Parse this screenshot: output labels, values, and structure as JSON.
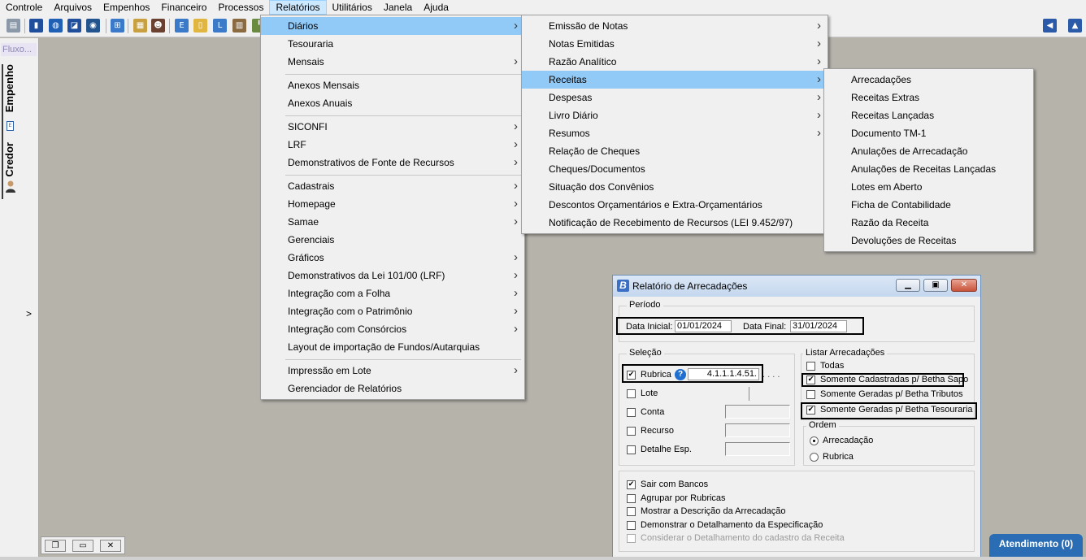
{
  "menubar": [
    "Controle",
    "Arquivos",
    "Empenhos",
    "Financeiro",
    "Processos",
    "Relatórios",
    "Utilitários",
    "Janela",
    "Ajuda"
  ],
  "active_menu": "Relatórios",
  "left_panel": {
    "fluxo_tab": "Fluxo...",
    "vertical_tabs": [
      "Empenho",
      "Credor"
    ],
    "expand_glyph": ">"
  },
  "relatorios_menu": [
    {
      "label": "Diários",
      "submenu": true,
      "highlighted": true
    },
    {
      "label": "Tesouraria",
      "submenu": false
    },
    {
      "label": "Mensais",
      "submenu": true
    },
    {
      "label": "Anexos Mensais",
      "submenu": false
    },
    {
      "label": "Anexos Anuais",
      "submenu": false
    },
    {
      "label": "SICONFI",
      "submenu": true
    },
    {
      "label": "LRF",
      "submenu": true
    },
    {
      "label": "Demonstrativos de Fonte de Recursos",
      "submenu": true
    },
    {
      "label": "Cadastrais",
      "submenu": true
    },
    {
      "label": "Homepage",
      "submenu": true
    },
    {
      "label": "Samae",
      "submenu": true
    },
    {
      "label": "Gerenciais",
      "submenu": false
    },
    {
      "label": "Gráficos",
      "submenu": true
    },
    {
      "label": "Demonstrativos da Lei 101/00 (LRF)",
      "submenu": true
    },
    {
      "label": "Integração com a Folha",
      "submenu": true
    },
    {
      "label": "Integração com o Patrimônio",
      "submenu": true
    },
    {
      "label": "Integração com Consórcios",
      "submenu": true
    },
    {
      "label": "Layout de importação de Fundos/Autarquias",
      "submenu": false
    },
    {
      "label": "Impressão em Lote",
      "submenu": true
    },
    {
      "label": "Gerenciador de Relatórios",
      "submenu": false
    }
  ],
  "diarios_menu": [
    {
      "label": "Emissão de Notas",
      "submenu": true
    },
    {
      "label": "Notas Emitidas",
      "submenu": true
    },
    {
      "label": "Razão Analítico",
      "submenu": true
    },
    {
      "label": "Receitas",
      "submenu": true,
      "highlighted": true
    },
    {
      "label": "Despesas",
      "submenu": true
    },
    {
      "label": "Livro Diário",
      "submenu": true
    },
    {
      "label": "Resumos",
      "submenu": true
    },
    {
      "label": "Relação de Cheques",
      "submenu": false
    },
    {
      "label": "Cheques/Documentos",
      "submenu": false
    },
    {
      "label": "Situação dos Convênios",
      "submenu": false
    },
    {
      "label": "Descontos Orçamentários e Extra-Orçamentários",
      "submenu": false
    },
    {
      "label": "Notificação de Recebimento de Recursos (LEI 9.452/97)",
      "submenu": false
    }
  ],
  "receitas_menu": [
    "Arrecadações",
    "Receitas Extras",
    "Receitas Lançadas",
    "Documento TM-1",
    "Anulações de Arrecadação",
    "Anulações de Receitas Lançadas",
    "Lotes em Aberto",
    "Ficha de Contabilidade",
    "Razão da Receita",
    "Devoluções de Receitas"
  ],
  "dialog": {
    "title": "Relatório de Arrecadações",
    "periodo": {
      "group_label": "Período",
      "data_inicial_label": "Data Inicial:",
      "data_inicial_value": "01/01/2024",
      "data_final_label": "Data Final:",
      "data_final_value": "31/01/2024"
    },
    "selecao": {
      "group_label": "Seleção",
      "rubrica": {
        "label": "Rubrica",
        "checked": true,
        "value": "4.1.1.1.4.51.",
        "trailing": ". . . ."
      },
      "lote": {
        "label": "Lote",
        "checked": false
      },
      "conta": {
        "label": "Conta",
        "checked": false
      },
      "recurso": {
        "label": "Recurso",
        "checked": false
      },
      "detalhe": {
        "label": "Detalhe Esp.",
        "checked": false
      }
    },
    "listar": {
      "group_label": "Listar Arrecadações",
      "options": [
        {
          "label": "Todas",
          "checked": false
        },
        {
          "label": "Somente Cadastradas p/ Betha Sapo",
          "checked": true
        },
        {
          "label": "Somente Geradas p/ Betha Tributos",
          "checked": false
        },
        {
          "label": "Somente Geradas p/ Betha Tesouraria",
          "checked": true
        }
      ]
    },
    "ordem": {
      "group_label": "Ordem",
      "options": [
        {
          "label": "Arrecadação",
          "selected": true
        },
        {
          "label": "Rubrica",
          "selected": false
        }
      ]
    },
    "opcoes": [
      {
        "label": "Sair com Bancos",
        "checked": true,
        "disabled": false
      },
      {
        "label": "Agrupar por Rubricas",
        "checked": false,
        "disabled": false
      },
      {
        "label": "Mostrar a Descrição da Arrecadação",
        "checked": false,
        "disabled": false
      },
      {
        "label": "Demonstrar o Detalhamento da Especificação",
        "checked": false,
        "disabled": false
      },
      {
        "label": "Considerar o Detalhamento do cadastro da Receita",
        "checked": false,
        "disabled": true
      }
    ]
  },
  "atendimento": "Atendimento (0)",
  "colors": {
    "highlight": "#91c9f7",
    "desktop": "#b5b3aa",
    "atendimento": "#2a6db4"
  }
}
